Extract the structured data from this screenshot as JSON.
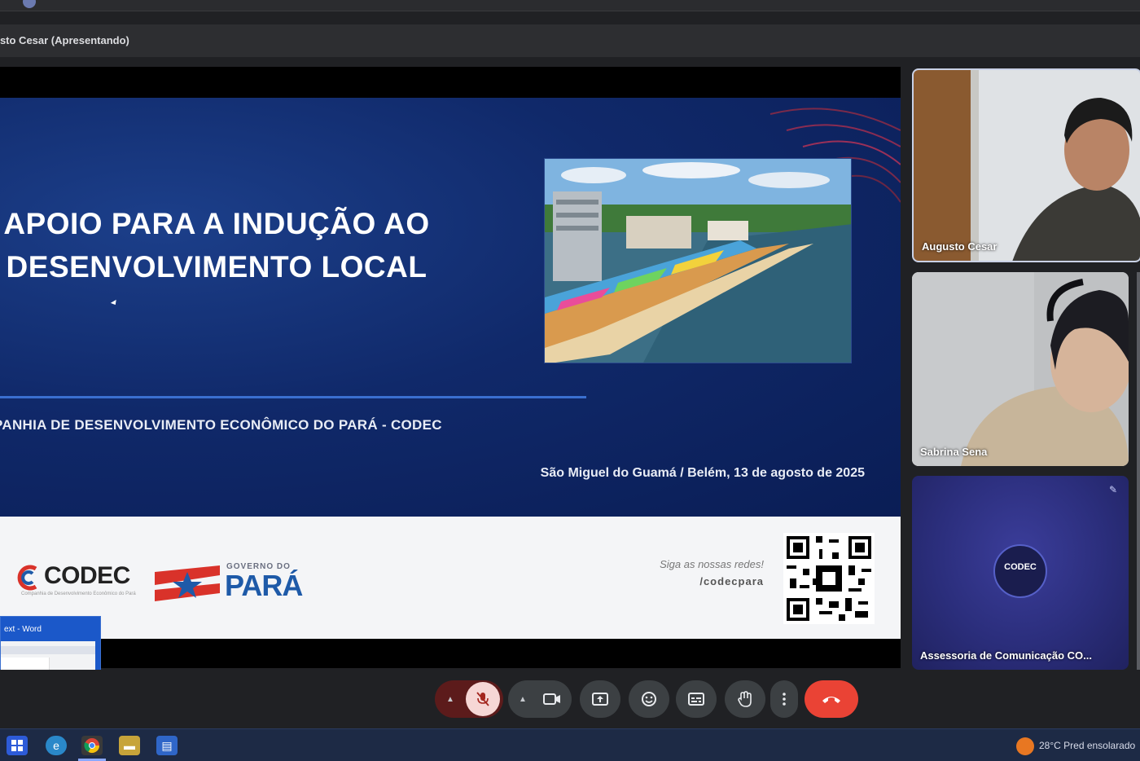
{
  "browser": {
    "tab_text": ""
  },
  "presenter": {
    "label": "usto Cesar (Apresentando)"
  },
  "slide": {
    "title_line1": "APOIO PARA A INDUÇÃO AO",
    "title_line2": "DESENVOLVIMENTO LOCAL",
    "org_name": "PANHIA DE DESENVOLVIMENTO ECONÔMICO DO PARÁ - CODEC",
    "place_date": "São Miguel do Guamá / Belém, 13 de agosto de 2025",
    "codec_logo_text": "CODEC",
    "codec_logo_sub": "Companhia de Desenvolvimento Econômico do Pará",
    "gov_label": "GOVERNO DO",
    "gov_word": "PARÁ",
    "social_line1": "Siga as nossas redes!",
    "social_handle": "/codecpara"
  },
  "thumbnail": {
    "title": "ext - Word"
  },
  "participants": [
    {
      "name": "Augusto Cesar"
    },
    {
      "name": "Sabrina Sena"
    },
    {
      "name": "Assessoria de Comunicação CO...",
      "avatar_text": "CODEC"
    }
  ],
  "controls": {
    "mic_icon": "mic-off-icon",
    "cam_icon": "camera-icon",
    "leave_icon": "phone-hangup-icon"
  },
  "taskbar": {
    "weather": "28°C  Pred ensolarado"
  },
  "colors": {
    "slide_blue": "#10296a",
    "leave_red": "#ea4335",
    "gov_blue": "#1e5aa8"
  }
}
